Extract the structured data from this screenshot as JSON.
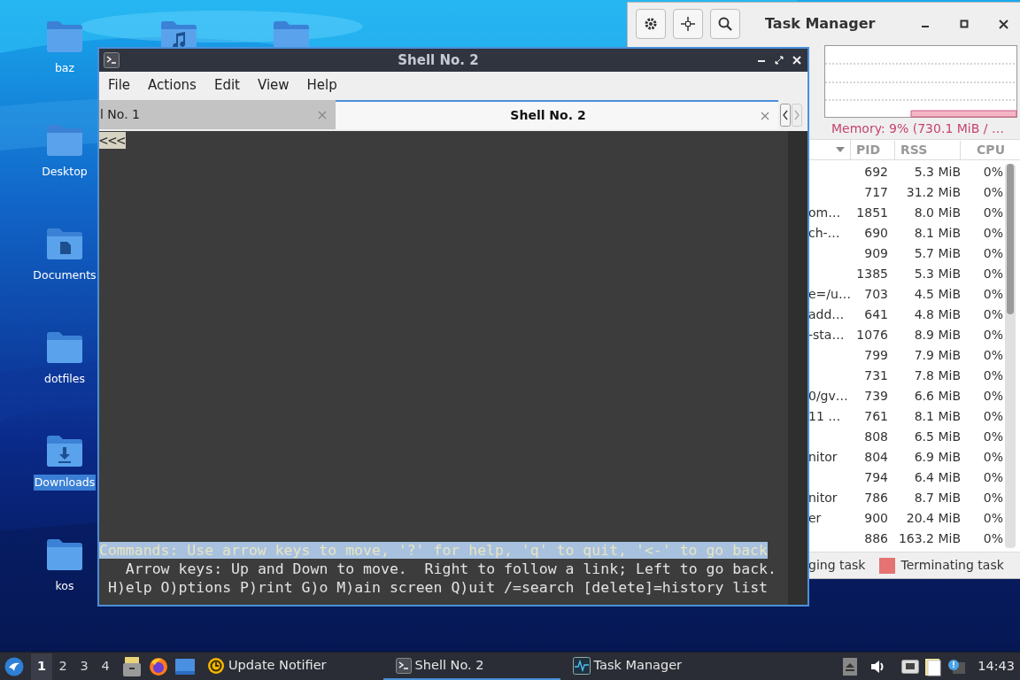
{
  "desktop_icons": [
    {
      "label": "baz",
      "kind": "folder",
      "selected": false
    },
    {
      "label": "Desktop",
      "kind": "folder",
      "selected": false
    },
    {
      "label": "Documents",
      "kind": "document",
      "selected": false
    },
    {
      "label": "dotfiles",
      "kind": "folder",
      "selected": false
    },
    {
      "label": "Downloads",
      "kind": "download",
      "selected": true
    },
    {
      "label": "kos",
      "kind": "folder",
      "selected": false
    }
  ],
  "task_manager": {
    "title": "Task Manager",
    "memory_label": "Memory: 9% (730.1 MiB / …",
    "columns": [
      "PID",
      "RSS",
      "CPU"
    ],
    "rows": [
      {
        "pid": "692",
        "rss": "5.3 MiB",
        "cpu": "0%"
      },
      {
        "pid": "717",
        "rss": "31.2 MiB",
        "cpu": "0%"
      },
      {
        "name": "om…",
        "pid": "1851",
        "rss": "8.0 MiB",
        "cpu": "0%"
      },
      {
        "name": "ch-…",
        "pid": "690",
        "rss": "8.1 MiB",
        "cpu": "0%"
      },
      {
        "pid": "909",
        "rss": "5.7 MiB",
        "cpu": "0%"
      },
      {
        "pid": "1385",
        "rss": "5.3 MiB",
        "cpu": "0%"
      },
      {
        "name": "e=/u…",
        "pid": "703",
        "rss": "4.5 MiB",
        "cpu": "0%"
      },
      {
        "name": "add…",
        "pid": "641",
        "rss": "4.8 MiB",
        "cpu": "0%"
      },
      {
        "name": "-sta…",
        "pid": "1076",
        "rss": "8.9 MiB",
        "cpu": "0%"
      },
      {
        "pid": "799",
        "rss": "7.9 MiB",
        "cpu": "0%"
      },
      {
        "pid": "731",
        "rss": "7.8 MiB",
        "cpu": "0%"
      },
      {
        "name": "0/gv…",
        "pid": "739",
        "rss": "6.6 MiB",
        "cpu": "0%"
      },
      {
        "name": "11 …",
        "pid": "761",
        "rss": "8.1 MiB",
        "cpu": "0%"
      },
      {
        "pid": "808",
        "rss": "6.5 MiB",
        "cpu": "0%"
      },
      {
        "name": "nitor",
        "pid": "804",
        "rss": "6.9 MiB",
        "cpu": "0%"
      },
      {
        "pid": "794",
        "rss": "6.4 MiB",
        "cpu": "0%"
      },
      {
        "name": "nitor",
        "pid": "786",
        "rss": "8.7 MiB",
        "cpu": "0%"
      },
      {
        "name": "er",
        "pid": "900",
        "rss": "20.4 MiB",
        "cpu": "0%"
      },
      {
        "pid": "886",
        "rss": "163.2 MiB",
        "cpu": "0%"
      }
    ],
    "legend": [
      {
        "label": "ging task"
      },
      {
        "label": "Terminating task",
        "color": "#e57373"
      }
    ]
  },
  "shell_window": {
    "title": "Shell No. 2",
    "menu": [
      "File",
      "Actions",
      "Edit",
      "View",
      "Help"
    ],
    "tabs": [
      {
        "label": "l No. 1",
        "selected": false
      },
      {
        "label": "Shell No. 2",
        "selected": true
      }
    ],
    "terminal": {
      "top_marker": "<<<",
      "status_line": "Commands: Use arrow keys to move, '?' for help, 'q' to quit, '<-' to go back",
      "help_lines": [
        "  Arrow keys: Up and Down to move.  Right to follow a link; Left to go back.",
        "H)elp O)ptions P)rint G)o M)ain screen Q)uit /=search [delete]=history list"
      ]
    }
  },
  "taskbar": {
    "workspaces": [
      {
        "label": "1",
        "selected": true
      },
      {
        "label": "2",
        "selected": false
      },
      {
        "label": "3",
        "selected": false
      },
      {
        "label": "4",
        "selected": false
      }
    ],
    "tasks": [
      {
        "label": "Update Notifier",
        "kind": "notifier",
        "selected": false
      },
      {
        "label": "Shell No. 2",
        "kind": "terminal",
        "selected": true
      },
      {
        "label": "Task Manager",
        "kind": "monitor",
        "selected": false
      }
    ],
    "clock": "14:43"
  }
}
